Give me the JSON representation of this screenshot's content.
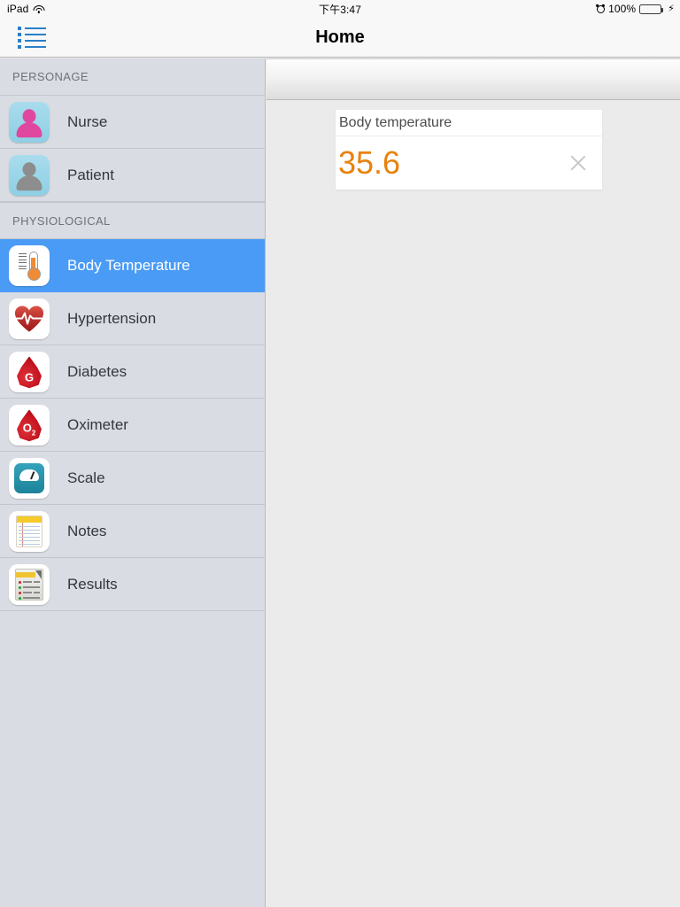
{
  "status_bar": {
    "carrier": "iPad",
    "wifi_icon": "wifi-icon",
    "time": "下午3:47",
    "alarm_icon": "alarm-clock-icon",
    "battery_percent": "100%",
    "battery_icon": "battery-full-icon",
    "charging_icon": "⚡",
    "battery_color": "#4cd763"
  },
  "navbar": {
    "title": "Home",
    "menu_icon": "list-menu-icon",
    "menu_icon_color": "#2a7fc9"
  },
  "sidebar": {
    "sections": [
      {
        "header": "PERSONAGE",
        "items": [
          {
            "label": "Nurse",
            "icon": "nurse-person-icon",
            "selected": false
          },
          {
            "label": "Patient",
            "icon": "patient-person-icon",
            "selected": false
          }
        ]
      },
      {
        "header": "PHYSIOLOGICAL",
        "items": [
          {
            "label": "Body Temperature",
            "icon": "thermometer-icon",
            "selected": true
          },
          {
            "label": "Hypertension",
            "icon": "heart-ecg-icon",
            "selected": false
          },
          {
            "label": "Diabetes",
            "icon": "blood-drop-g-icon",
            "selected": false
          },
          {
            "label": "Oximeter",
            "icon": "blood-drop-o2-icon",
            "selected": false
          },
          {
            "label": "Scale",
            "icon": "weight-scale-icon",
            "selected": false
          },
          {
            "label": "Notes",
            "icon": "notepad-icon",
            "selected": false
          },
          {
            "label": "Results",
            "icon": "results-doc-icon",
            "selected": false
          }
        ]
      }
    ],
    "selected_color": "#4a9bf5",
    "background_color": "#d9dce3"
  },
  "main": {
    "card": {
      "title": "Body temperature",
      "value": "35.6",
      "value_color": "#e8820c",
      "close_icon": "close-x-icon"
    }
  }
}
